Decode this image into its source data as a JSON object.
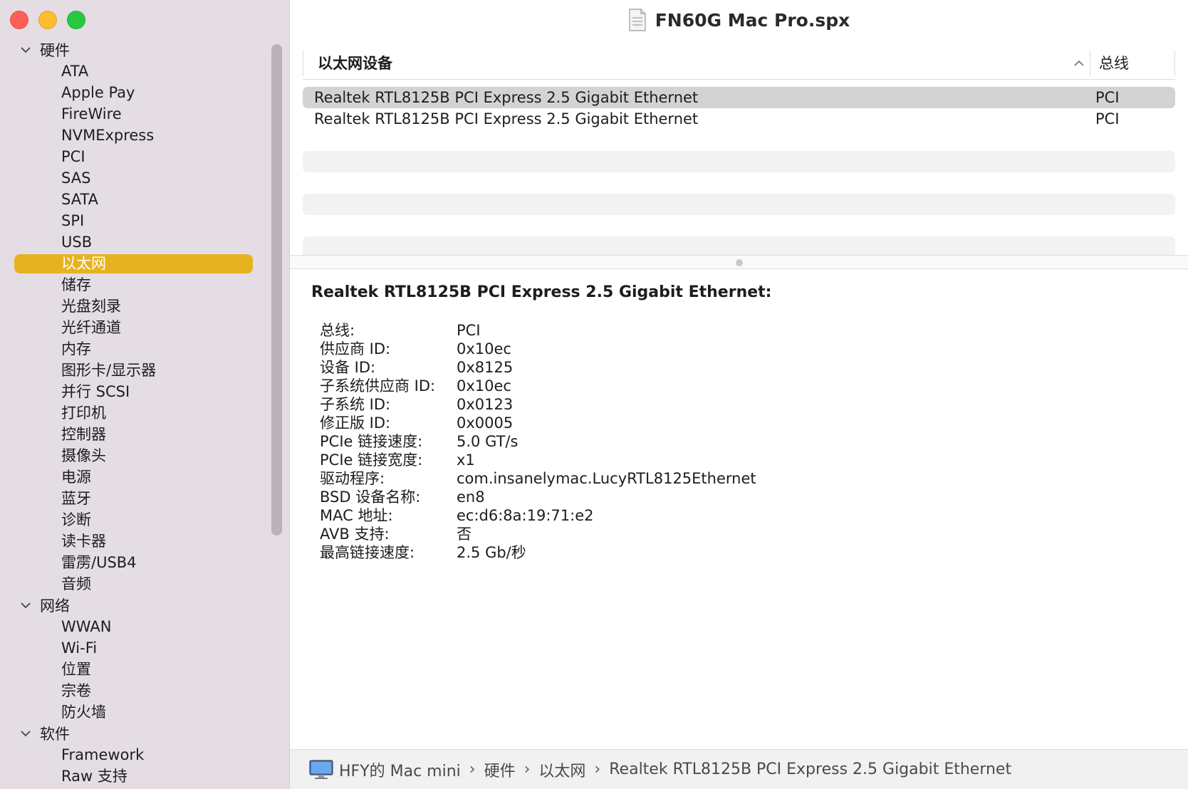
{
  "window": {
    "title": "FN60G Mac Pro.spx"
  },
  "sidebar": {
    "groups": [
      {
        "label": "硬件",
        "items": [
          "ATA",
          "Apple Pay",
          "FireWire",
          "NVMExpress",
          "PCI",
          "SAS",
          "SATA",
          "SPI",
          "USB",
          "以太网",
          "储存",
          "光盘刻录",
          "光纤通道",
          "内存",
          "图形卡/显示器",
          "并行 SCSI",
          "打印机",
          "控制器",
          "摄像头",
          "电源",
          "蓝牙",
          "诊断",
          "读卡器",
          "雷雳/USB4",
          "音频"
        ]
      },
      {
        "label": "网络",
        "items": [
          "WWAN",
          "Wi-Fi",
          "位置",
          "宗卷",
          "防火墙"
        ]
      },
      {
        "label": "软件",
        "items": [
          "Framework",
          "Raw 支持"
        ]
      }
    ],
    "selected": "以太网"
  },
  "table": {
    "col_name": "以太网设备",
    "col_bus": "总线",
    "rows": [
      {
        "name": "Realtek RTL8125B PCI Express 2.5 Gigabit Ethernet",
        "bus": "PCI"
      },
      {
        "name": "Realtek RTL8125B PCI Express 2.5 Gigabit Ethernet",
        "bus": "PCI"
      }
    ]
  },
  "detail": {
    "title": "Realtek RTL8125B PCI Express 2.5 Gigabit Ethernet:",
    "props": [
      {
        "k": "总线:",
        "v": "PCI"
      },
      {
        "k": "供应商 ID:",
        "v": "0x10ec"
      },
      {
        "k": "设备 ID:",
        "v": "0x8125"
      },
      {
        "k": "子系统供应商 ID:",
        "v": "0x10ec"
      },
      {
        "k": "子系统 ID:",
        "v": "0x0123"
      },
      {
        "k": "修正版 ID:",
        "v": "0x0005"
      },
      {
        "k": "PCIe 链接速度:",
        "v": "5.0 GT/s"
      },
      {
        "k": "PCIe 链接宽度:",
        "v": "x1"
      },
      {
        "k": "驱动程序:",
        "v": "com.insanelymac.LucyRTL8125Ethernet"
      },
      {
        "k": "BSD 设备名称:",
        "v": "en8"
      },
      {
        "k": "MAC 地址:",
        "v": "ec:d6:8a:19:71:e2"
      },
      {
        "k": "AVB 支持:",
        "v": "否"
      },
      {
        "k": "最高链接速度:",
        "v": "2.5 Gb/秒"
      }
    ]
  },
  "pathbar": {
    "segments": [
      "HFY的 Mac mini",
      "硬件",
      "以太网",
      "Realtek RTL8125B PCI Express 2.5 Gigabit Ethernet"
    ]
  },
  "colors": {
    "sidebar_bg": "#e4dde4",
    "selection": "#e7b21f",
    "row_selected": "#d3d3d3"
  }
}
